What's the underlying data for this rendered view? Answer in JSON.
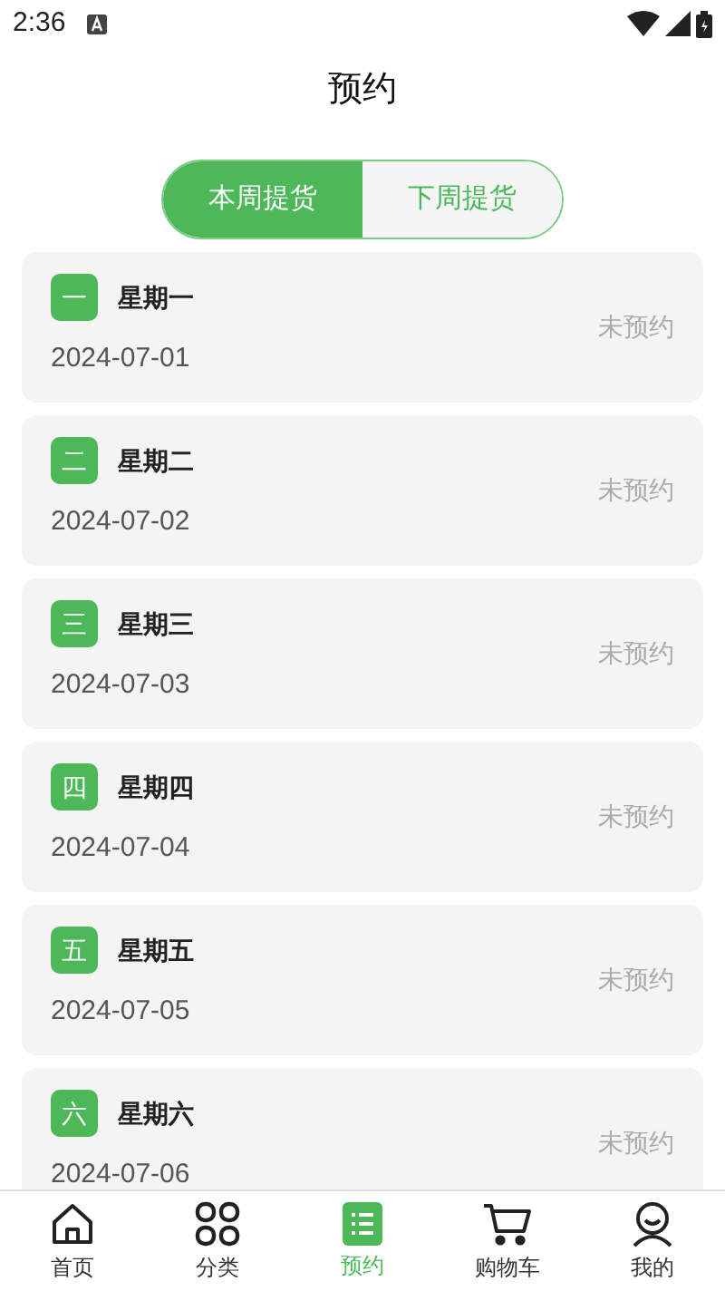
{
  "status_bar": {
    "time": "2:36"
  },
  "header": {
    "title": "预约"
  },
  "tabs": [
    {
      "label": "本周提货",
      "selected": true
    },
    {
      "label": "下周提货",
      "selected": false
    }
  ],
  "days": [
    {
      "badge": "一",
      "name": "星期一",
      "date": "2024-07-01",
      "status": "未预约"
    },
    {
      "badge": "二",
      "name": "星期二",
      "date": "2024-07-02",
      "status": "未预约"
    },
    {
      "badge": "三",
      "name": "星期三",
      "date": "2024-07-03",
      "status": "未预约"
    },
    {
      "badge": "四",
      "name": "星期四",
      "date": "2024-07-04",
      "status": "未预约"
    },
    {
      "badge": "五",
      "name": "星期五",
      "date": "2024-07-05",
      "status": "未预约"
    },
    {
      "badge": "六",
      "name": "星期六",
      "date": "2024-07-06",
      "status": "未预约"
    }
  ],
  "nav": [
    {
      "kind": "home",
      "label": "首页",
      "selected": false
    },
    {
      "kind": "category",
      "label": "分类",
      "selected": false
    },
    {
      "kind": "booking",
      "label": "预约",
      "selected": true
    },
    {
      "kind": "cart",
      "label": "购物车",
      "selected": false
    },
    {
      "kind": "profile",
      "label": "我的",
      "selected": false
    }
  ]
}
